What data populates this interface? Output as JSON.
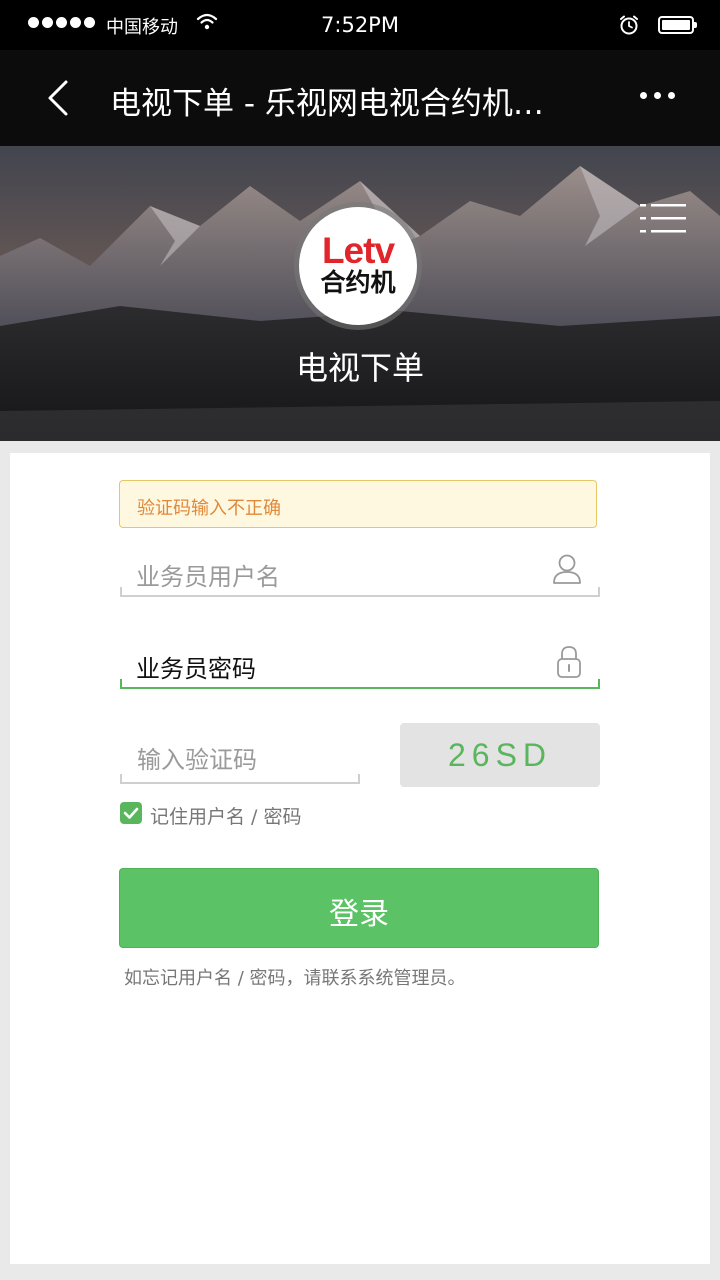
{
  "status_bar": {
    "carrier": "中国移动",
    "time": "7:52PM",
    "signal_icon": "signal-dots-icon",
    "wifi_icon": "wifi-icon",
    "alarm_icon": "alarm-icon",
    "battery_icon": "battery-icon",
    "battery_level": 0.95
  },
  "nav": {
    "title": "电视下单 - 乐视网电视合约机…",
    "back_icon": "back-icon",
    "more_icon": "more-icon"
  },
  "hero": {
    "logo_top": "Letv",
    "logo_bottom": "合约机",
    "title": "电视下单",
    "menu_icon": "menu-icon"
  },
  "form": {
    "error_message": "验证码输入不正确",
    "username_placeholder": "业务员用户名",
    "password_value": "业务员密码",
    "captcha_placeholder": "输入验证码",
    "captcha_code": "26SD",
    "remember_label": "记住用户名 / 密码",
    "remember_checked": true,
    "login_label": "登录",
    "hint": "如忘记用户名 / 密码，请联系系统管理员。"
  },
  "colors": {
    "accent_green": "#5bc365",
    "error_text": "#e0893a",
    "error_bg": "#fff8e1",
    "logo_red": "#e0252b"
  }
}
